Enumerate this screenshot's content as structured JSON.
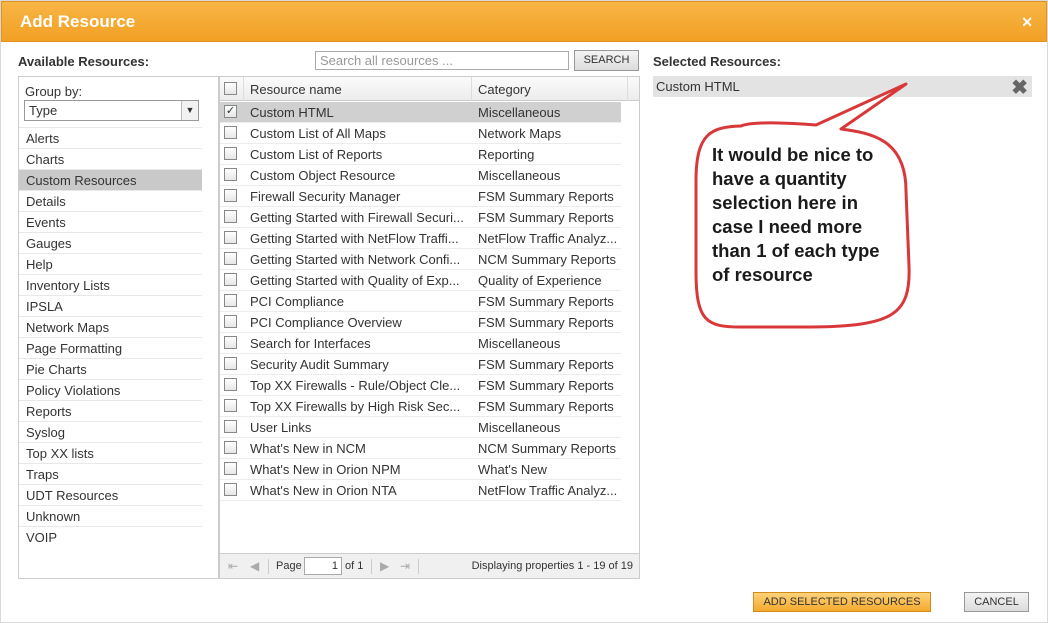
{
  "dialog": {
    "title": "Add Resource",
    "close_icon": "close-icon"
  },
  "available_label": "Available Resources:",
  "search": {
    "placeholder": "Search all resources ...",
    "button_label": "SEARCH"
  },
  "group_by": {
    "label": "Group by:",
    "selected": "Type"
  },
  "categories": [
    {
      "label": "Alerts"
    },
    {
      "label": "Charts"
    },
    {
      "label": "Custom Resources",
      "selected": true
    },
    {
      "label": "Details"
    },
    {
      "label": "Events"
    },
    {
      "label": "Gauges"
    },
    {
      "label": "Help"
    },
    {
      "label": "Inventory Lists"
    },
    {
      "label": "IPSLA"
    },
    {
      "label": "Network Maps"
    },
    {
      "label": "Page Formatting"
    },
    {
      "label": "Pie Charts"
    },
    {
      "label": "Policy Violations"
    },
    {
      "label": "Reports"
    },
    {
      "label": "Syslog"
    },
    {
      "label": "Top XX lists"
    },
    {
      "label": "Traps"
    },
    {
      "label": "UDT Resources"
    },
    {
      "label": "Unknown"
    },
    {
      "label": "VOIP"
    }
  ],
  "grid": {
    "headers": {
      "name": "Resource name",
      "category": "Category"
    },
    "rows": [
      {
        "name": "Custom HTML",
        "category": "Miscellaneous",
        "checked": true
      },
      {
        "name": "Custom List of All Maps",
        "category": "Network Maps"
      },
      {
        "name": "Custom List of Reports",
        "category": "Reporting"
      },
      {
        "name": "Custom Object Resource",
        "category": "Miscellaneous"
      },
      {
        "name": "Firewall Security Manager",
        "category": "FSM Summary Reports"
      },
      {
        "name": "Getting Started with Firewall Securi...",
        "category": "FSM Summary Reports"
      },
      {
        "name": "Getting Started with NetFlow Traffi...",
        "category": "NetFlow Traffic Analyz..."
      },
      {
        "name": "Getting Started with Network Confi...",
        "category": "NCM Summary Reports"
      },
      {
        "name": "Getting Started with Quality of Exp...",
        "category": "Quality of Experience"
      },
      {
        "name": "PCI Compliance",
        "category": "FSM Summary Reports"
      },
      {
        "name": "PCI Compliance Overview",
        "category": "FSM Summary Reports"
      },
      {
        "name": "Search for Interfaces",
        "category": "Miscellaneous"
      },
      {
        "name": "Security Audit Summary",
        "category": "FSM Summary Reports"
      },
      {
        "name": "Top XX Firewalls - Rule/Object Cle...",
        "category": "FSM Summary Reports"
      },
      {
        "name": "Top XX Firewalls by High Risk Sec...",
        "category": "FSM Summary Reports"
      },
      {
        "name": "User Links",
        "category": "Miscellaneous"
      },
      {
        "name": "What's New in NCM",
        "category": "NCM Summary Reports"
      },
      {
        "name": "What's New in Orion NPM",
        "category": "What's New"
      },
      {
        "name": "What's New in Orion NTA",
        "category": "NetFlow Traffic Analyz..."
      }
    ],
    "pager": {
      "page_label": "Page",
      "page_value": "1",
      "of_label": "of 1",
      "display_text": "Displaying properties 1 - 19 of 19"
    }
  },
  "selected_label": "Selected Resources:",
  "selected_items": [
    {
      "name": "Custom HTML"
    }
  ],
  "callout": {
    "text": "It would be nice to have a quantity selection here in case I need more than 1 of each type of resource"
  },
  "buttons": {
    "add": "ADD SELECTED RESOURCES",
    "cancel": "CANCEL"
  },
  "colors": {
    "titlebar": "#f2a024",
    "callout_border": "#d9383a",
    "selected_row": "#c9c9c9"
  }
}
